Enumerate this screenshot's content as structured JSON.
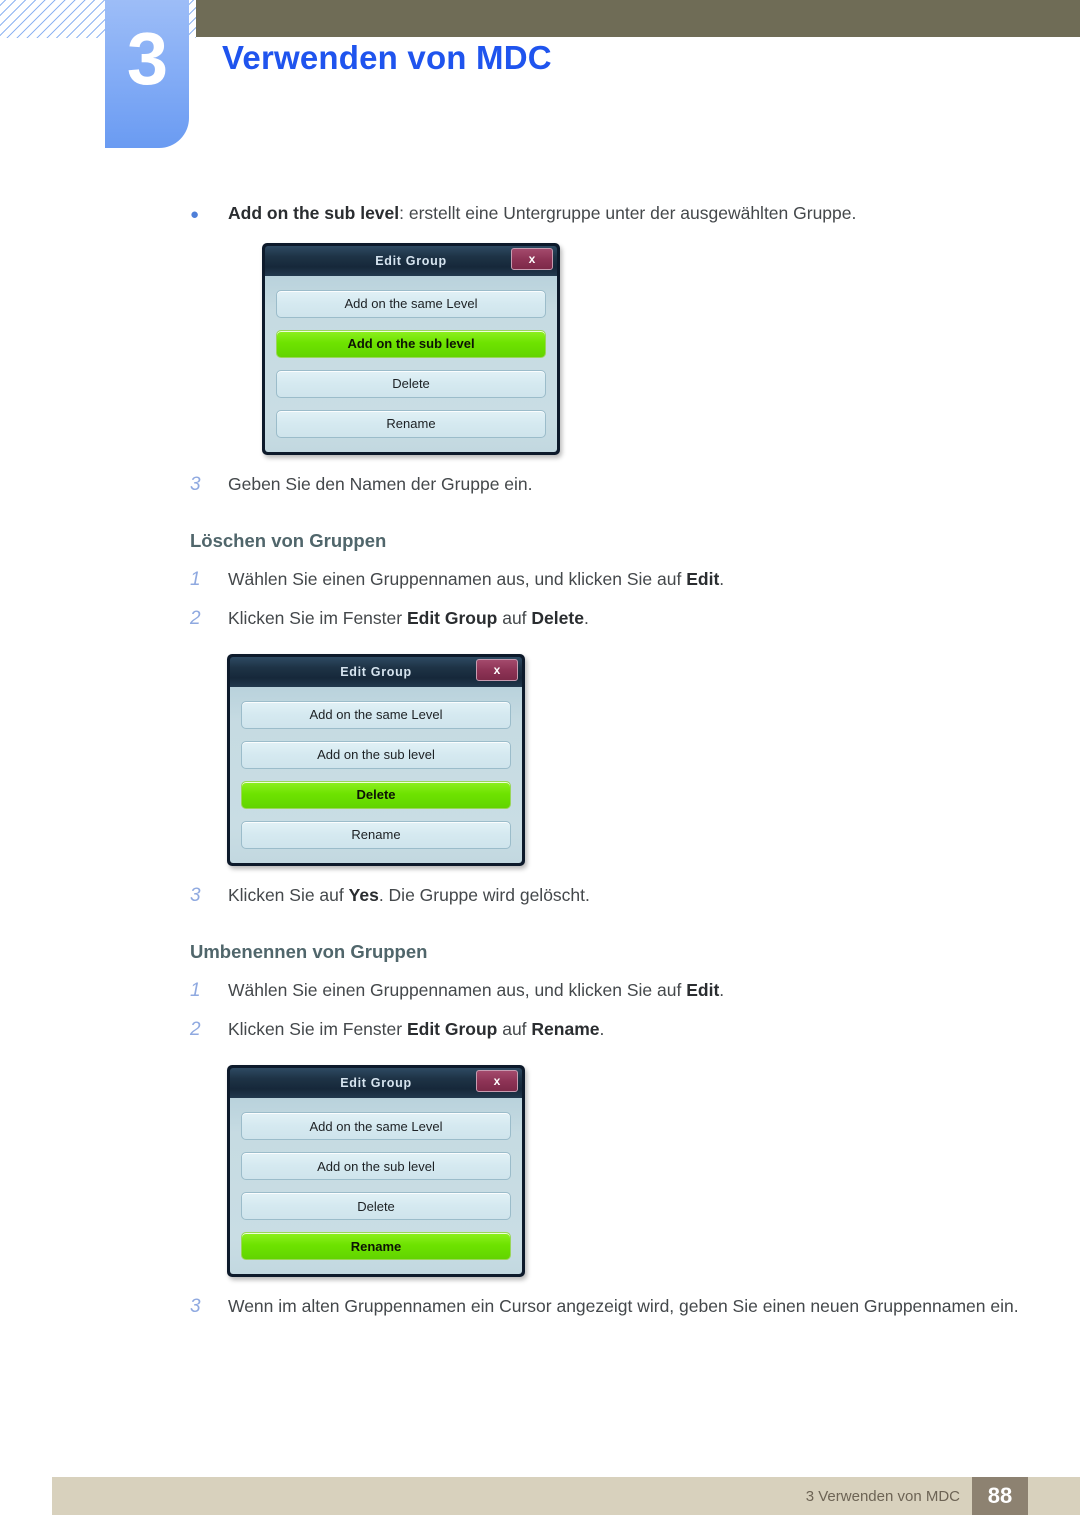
{
  "header": {
    "chapter_number": "3",
    "title": "Verwenden von MDC",
    "accent_blue": "#1f54ee",
    "tab_blue": "#86aef6",
    "bar_color": "#6f6c56"
  },
  "content": {
    "bullet": {
      "marker": "●",
      "bold_label": "Add on the sub level",
      "text": ": erstellt eine Untergruppe unter der ausgewählten Gruppe."
    },
    "step_add_3": {
      "number": "3",
      "text": "Geben Sie den Namen der Gruppe ein."
    },
    "section_delete": {
      "heading": "Löschen von Gruppen",
      "steps": [
        {
          "number": "1",
          "pre": "Wählen Sie einen Gruppennamen aus, und klicken Sie auf ",
          "bold": "Edit",
          "post": "."
        },
        {
          "number": "2",
          "pre": "Klicken Sie im Fenster ",
          "bold": "Edit Group",
          "mid": " auf ",
          "bold2": "Delete",
          "post": "."
        },
        {
          "number": "3",
          "pre": "Klicken Sie auf ",
          "bold": "Yes",
          "post": ". Die Gruppe wird gelöscht."
        }
      ]
    },
    "section_rename": {
      "heading": "Umbenennen von Gruppen",
      "steps": [
        {
          "number": "1",
          "pre": "Wählen Sie einen Gruppennamen aus, und klicken Sie auf ",
          "bold": "Edit",
          "post": "."
        },
        {
          "number": "2",
          "pre": "Klicken Sie im Fenster ",
          "bold": "Edit Group",
          "mid": " auf ",
          "bold2": "Rename",
          "post": "."
        },
        {
          "number": "3",
          "pre": "Wenn im alten Gruppennamen ein Cursor angezeigt wird, geben Sie einen neuen Gruppennamen ein."
        }
      ]
    }
  },
  "dialogs": [
    {
      "title": "Edit Group",
      "close_label": "x",
      "buttons": [
        {
          "label": "Add on the same Level",
          "highlighted": false
        },
        {
          "label": "Add on the sub level",
          "highlighted": true
        },
        {
          "label": "Delete",
          "highlighted": false
        },
        {
          "label": "Rename",
          "highlighted": false
        }
      ]
    },
    {
      "title": "Edit Group",
      "close_label": "x",
      "buttons": [
        {
          "label": "Add on the same Level",
          "highlighted": false
        },
        {
          "label": "Add on the sub level",
          "highlighted": false
        },
        {
          "label": "Delete",
          "highlighted": true
        },
        {
          "label": "Rename",
          "highlighted": false
        }
      ]
    },
    {
      "title": "Edit Group",
      "close_label": "x",
      "buttons": [
        {
          "label": "Add on the same Level",
          "highlighted": false
        },
        {
          "label": "Add on the sub level",
          "highlighted": false
        },
        {
          "label": "Delete",
          "highlighted": false
        },
        {
          "label": "Rename",
          "highlighted": true
        }
      ]
    }
  ],
  "footer": {
    "text": "3 Verwenden von MDC",
    "page_number": "88",
    "bar_color": "#d8d1bd",
    "page_box_color": "#8d8271"
  }
}
